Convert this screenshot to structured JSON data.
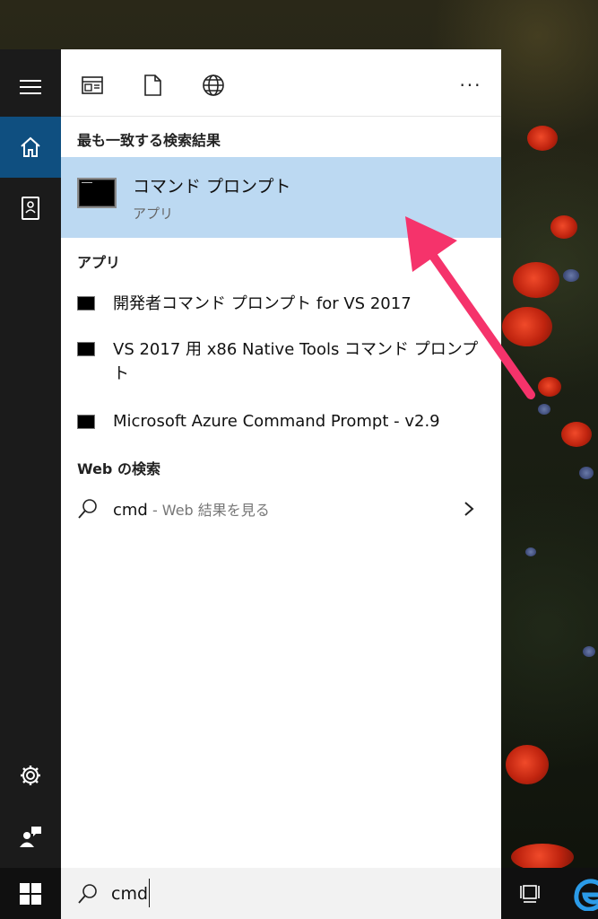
{
  "toolbar": {
    "more_label": "···"
  },
  "best_match": {
    "section_label": "最も一致する検索結果",
    "title": "コマンド プロンプト",
    "subtitle": "アプリ"
  },
  "apps": {
    "section_label": "アプリ",
    "items": [
      {
        "label": "開発者コマンド プロンプト for VS 2017"
      },
      {
        "label": "VS 2017 用 x86 Native Tools コマンド プロンプト"
      },
      {
        "label": "Microsoft Azure Command Prompt - v2.9"
      }
    ]
  },
  "web": {
    "section_label": "Web の検索",
    "query": "cmd",
    "suffix": " - Web 結果を見る"
  },
  "search": {
    "value": "cmd"
  },
  "colors": {
    "accent": "#0f4f80",
    "highlight": "#bcd9f2",
    "arrow": "#f5336b"
  },
  "icons": {
    "rail": [
      "hamburger-icon",
      "home-icon",
      "notebook-icon",
      "settings-icon",
      "feedback-icon"
    ],
    "toolbar": [
      "apps-filter-icon",
      "documents-filter-icon",
      "web-filter-icon"
    ],
    "taskbar": [
      "windows-logo-icon",
      "search-icon",
      "task-view-icon",
      "edge-icon"
    ]
  }
}
